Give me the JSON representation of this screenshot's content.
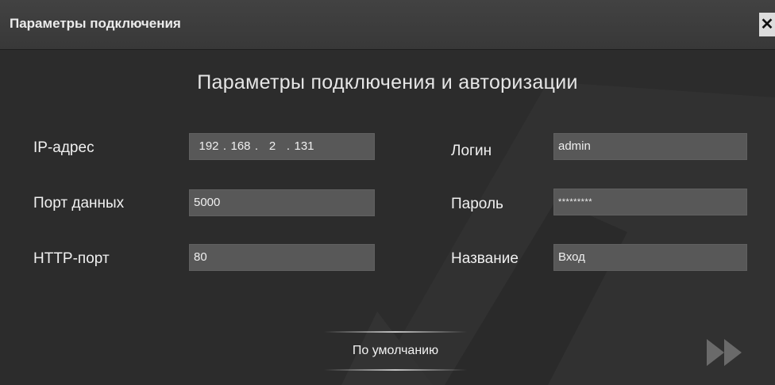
{
  "window": {
    "title": "Параметры подключения",
    "close_glyph": "✕"
  },
  "heading": "Параметры подключения и авторизации",
  "fields": {
    "ip": {
      "label": "IP-адрес",
      "octets": [
        "192",
        "168",
        "2",
        "131"
      ],
      "separator": "."
    },
    "data_port": {
      "label": "Порт данных",
      "value": "5000"
    },
    "http_port": {
      "label": "HTTP-порт",
      "value": "80"
    },
    "login": {
      "label": "Логин",
      "value": "admin"
    },
    "password": {
      "label": "Пароль",
      "value": "*********"
    },
    "name": {
      "label": "Название",
      "value": "Вход"
    }
  },
  "buttons": {
    "default_label": "По умолчанию",
    "next_icon": "fast-forward-icon"
  },
  "colors": {
    "background": "#2c2c2c",
    "titlebar": "#3c3c3c",
    "field": "#585858",
    "text": "#f0f0f0"
  }
}
